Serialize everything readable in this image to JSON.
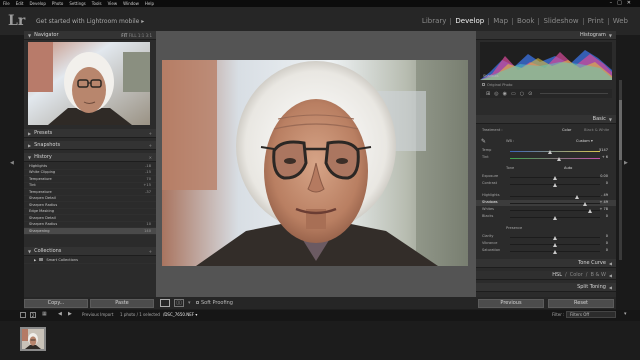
{
  "menu": [
    "File",
    "Edit",
    "Develop",
    "Photo",
    "Settings",
    "Tools",
    "View",
    "Window",
    "Help"
  ],
  "identity_plate": {
    "logo": "Lr",
    "title": "Get started with Lightroom mobile",
    "arrow": "▸"
  },
  "modules": [
    "Library",
    "Develop",
    "Map",
    "Book",
    "Slideshow",
    "Print",
    "Web"
  ],
  "active_module": "Develop",
  "navigator": {
    "title": "Navigator",
    "zoom_options": [
      "FIT",
      "FILL",
      "1:1",
      "3:1"
    ]
  },
  "presets": {
    "title": "Presets"
  },
  "snapshots": {
    "title": "Snapshots"
  },
  "history": {
    "title": "History",
    "items": [
      {
        "label": "Highlights",
        "value": "-18"
      },
      {
        "label": "White Clipping",
        "value": "-15"
      },
      {
        "label": "Temperature",
        "value": "70"
      },
      {
        "label": "Tint",
        "value": "+15"
      },
      {
        "label": "Temperature",
        "value": "-37"
      },
      {
        "label": "Sharpen Detail",
        "value": ""
      },
      {
        "label": "Sharpen Radius",
        "value": ""
      },
      {
        "label": "Edge Masking",
        "value": ""
      },
      {
        "label": "Sharpen Detail",
        "value": ""
      },
      {
        "label": "Sharpen Radius",
        "value": "10"
      },
      {
        "label": "Sharpening",
        "value": "140"
      }
    ]
  },
  "collections": {
    "title": "Collections",
    "items": [
      "Smart Collections"
    ]
  },
  "left_buttons": {
    "copy": "Copy...",
    "paste": "Paste"
  },
  "toolbar": {
    "soft_proofing": "Soft Proofing"
  },
  "histogram": {
    "title": "Histogram",
    "info": "Shadows",
    "original": "Original Photo"
  },
  "basic": {
    "title": "Basic",
    "treatment_label": "Treatment :",
    "treatment_options": [
      "Color",
      "Black & White"
    ],
    "wb_label": "WB :",
    "wb_value": "Custom",
    "tone_label": "Tone",
    "tone_auto": "Auto",
    "presence_label": "Presence",
    "sliders": [
      {
        "label": "Temp",
        "value": "5147"
      },
      {
        "label": "Tint",
        "value": "+ 6"
      },
      {
        "label": "Exposure",
        "value": "0.00"
      },
      {
        "label": "Contrast",
        "value": "0"
      },
      {
        "label": "Highlights",
        "value": "- 49"
      },
      {
        "label": "Shadows",
        "value": "+ 49"
      },
      {
        "label": "Whites",
        "value": "+ 78"
      },
      {
        "label": "Blacks",
        "value": "0"
      },
      {
        "label": "Clarity",
        "value": "0"
      },
      {
        "label": "Vibrance",
        "value": "0"
      },
      {
        "label": "Saturation",
        "value": "0"
      }
    ]
  },
  "hsl_tabs": [
    "HSL",
    "/",
    "Color",
    "/",
    "B & W"
  ],
  "tone_curve": {
    "title": "Tone Curve"
  },
  "split_toning": {
    "title": "Split Toning"
  },
  "right_buttons": {
    "previous": "Previous",
    "reset": "Reset"
  },
  "filmstrip": {
    "nav_pages": [
      "1",
      "2"
    ],
    "source": "Previous Import",
    "count": "1 photo / 1 selected",
    "filename": "/DSC_7650.NEF",
    "filter_label": "Filter :",
    "filter_value": "Filters Off"
  },
  "colors": {
    "accent": "#f2f2f2",
    "panel": "#2b2b2b",
    "background": "#545454"
  }
}
